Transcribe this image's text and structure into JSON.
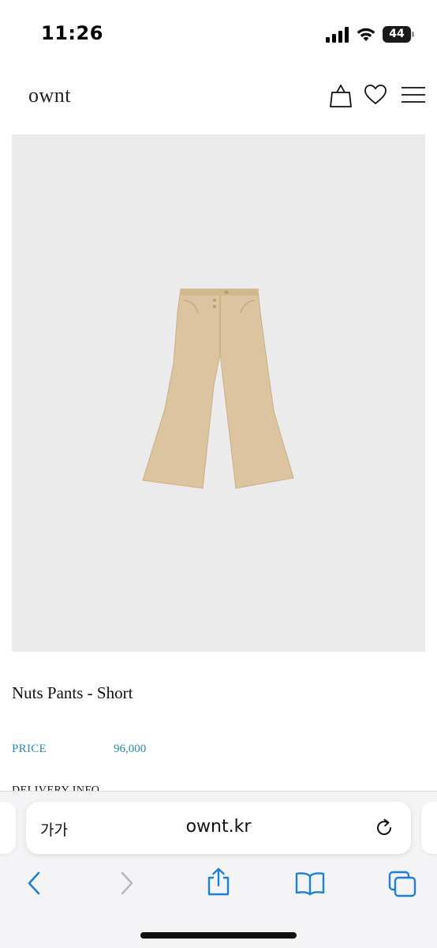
{
  "status_bar": {
    "time": "11:26",
    "battery_level": "44",
    "icons": [
      "cellular-signal-icon",
      "wifi-icon",
      "battery-icon"
    ]
  },
  "header": {
    "logo": "ownt",
    "icons": [
      "shopping-bag-icon",
      "heart-icon",
      "hamburger-menu-icon"
    ]
  },
  "product": {
    "image_background": "#ebebeb",
    "pants_color": "#dcc4a0",
    "title": "Nuts Pants - Short",
    "price_label": "PRICE",
    "price_value": "96,000",
    "delivery_label": "DELIVERY INFO"
  },
  "colors": {
    "price_accent": "#2a8aa8",
    "safari_tint": "#1e7fd6"
  },
  "browser": {
    "text_size_button": "가가",
    "url": "ownt.kr",
    "toolbar_icons": [
      "back-icon",
      "forward-icon",
      "share-icon",
      "bookmarks-icon",
      "tabs-icon",
      "reload-icon"
    ]
  }
}
